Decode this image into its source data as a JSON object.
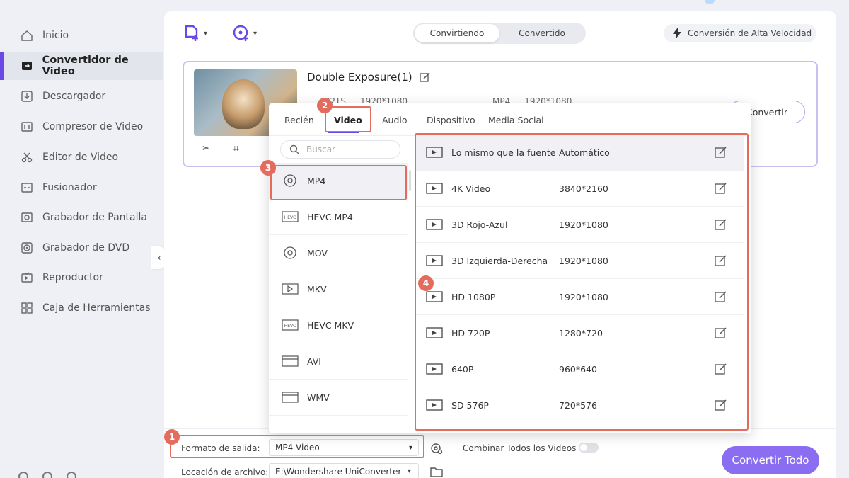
{
  "sidebar": {
    "items": [
      {
        "label": "Inicio",
        "icon": "home-icon"
      },
      {
        "label": "Convertidor de Video",
        "icon": "converter-icon",
        "active": true
      },
      {
        "label": "Descargador",
        "icon": "download-icon"
      },
      {
        "label": "Compresor de Video",
        "icon": "compress-icon"
      },
      {
        "label": "Editor de Video",
        "icon": "scissors-icon"
      },
      {
        "label": "Fusionador",
        "icon": "merge-icon"
      },
      {
        "label": "Grabador de Pantalla",
        "icon": "screen-record-icon"
      },
      {
        "label": "Grabador de DVD",
        "icon": "dvd-icon"
      },
      {
        "label": "Reproductor",
        "icon": "player-icon"
      },
      {
        "label": "Caja de Herramientas",
        "icon": "toolbox-icon"
      }
    ]
  },
  "header": {
    "tabs": [
      "Convirtiendo",
      "Convertido"
    ],
    "active_tab": "Convirtiendo",
    "high_speed_label": "Conversión de Alta Velocidad"
  },
  "video": {
    "title": "Double Exposure(1)",
    "source_format": "M2TS",
    "source_res": "1920*1080",
    "target_format": "MP4",
    "target_res": "1920*1080",
    "convert_label": "Convertir"
  },
  "popup": {
    "tabs": [
      "Recién",
      "Video",
      "Audio",
      "Dispositivo",
      "Media Social"
    ],
    "active_tab": "Video",
    "search_placeholder": "Buscar",
    "formats": [
      "MP4",
      "HEVC MP4",
      "MOV",
      "MKV",
      "HEVC MKV",
      "AVI",
      "WMV"
    ],
    "active_format": "MP4",
    "presets": [
      {
        "name": "Lo mismo que la fuente",
        "res": "Automático"
      },
      {
        "name": "4K Video",
        "res": "3840*2160"
      },
      {
        "name": "3D Rojo-Azul",
        "res": "1920*1080"
      },
      {
        "name": "3D Izquierda-Derecha",
        "res": "1920*1080"
      },
      {
        "name": "HD 1080P",
        "res": "1920*1080"
      },
      {
        "name": "HD 720P",
        "res": "1280*720"
      },
      {
        "name": "640P",
        "res": "960*640"
      },
      {
        "name": "SD 576P",
        "res": "720*576"
      }
    ]
  },
  "bottom": {
    "output_label": "Formato de salida:",
    "output_value": "MP4 Video",
    "merge_label": "Combinar Todos los Videos",
    "location_label": "Locación de archivo:",
    "location_value": "E:\\Wondershare UniConverter",
    "convert_all_label": "Convertir Todo"
  },
  "annotations": [
    "1",
    "2",
    "3",
    "4"
  ],
  "colors": {
    "accent": "#6b49e6",
    "highlight": "#e46c5f",
    "convert_all": "#8a6df0"
  }
}
